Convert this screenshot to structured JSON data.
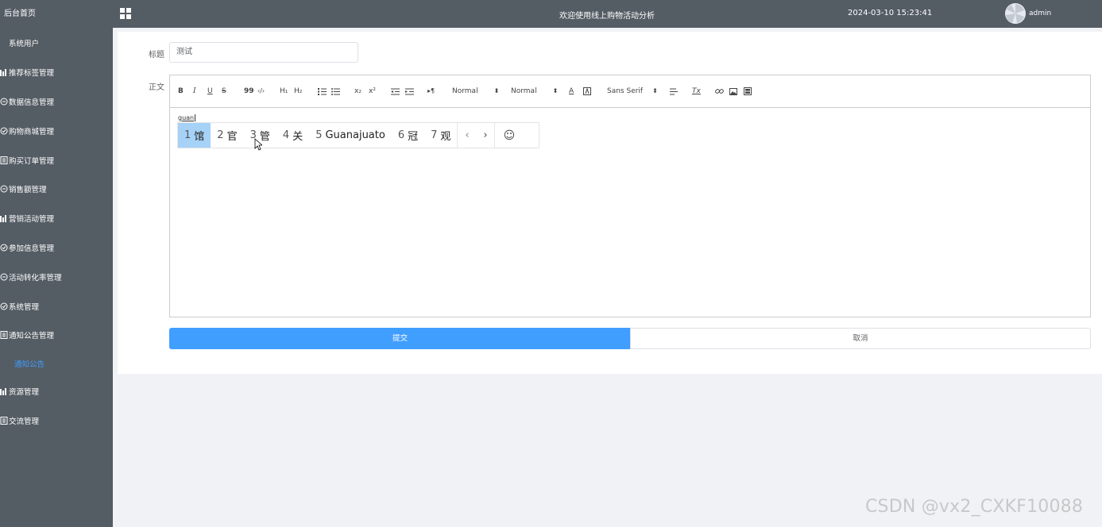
{
  "sidebar": {
    "home": "后台首页",
    "items": [
      {
        "label": "系统用户",
        "icon": "user-icon"
      },
      {
        "label": "推荐标签管理",
        "icon": "bar-chart-icon"
      },
      {
        "label": "数据信息管理",
        "icon": "circle-minus-icon"
      },
      {
        "label": "购物商城管理",
        "icon": "check-circle-icon"
      },
      {
        "label": "购买订单管理",
        "icon": "document-icon"
      },
      {
        "label": "销售额管理",
        "icon": "circle-minus-icon"
      },
      {
        "label": "营销活动管理",
        "icon": "bar-chart-icon"
      },
      {
        "label": "参加信息管理",
        "icon": "check-circle-icon"
      },
      {
        "label": "活动转化率管理",
        "icon": "circle-minus-icon"
      },
      {
        "label": "系统管理",
        "icon": "check-circle-icon"
      },
      {
        "label": "通知公告管理",
        "icon": "document-icon"
      }
    ],
    "active_sub": "通知公告",
    "items_after": [
      {
        "label": "资源管理",
        "icon": "bar-chart-icon"
      },
      {
        "label": "交流管理",
        "icon": "document-icon"
      }
    ]
  },
  "header": {
    "title": "欢迎使用线上购物活动分析",
    "datetime": "2024-03-10 15:23:41",
    "user": "admin"
  },
  "form": {
    "title_label": "标题",
    "title_value": "测试",
    "body_label": "正文",
    "editor_text": "guan",
    "submit_label": "提交",
    "cancel_label": "取消"
  },
  "toolbar": {
    "bold": "B",
    "italic": "I",
    "underline": "U",
    "strike": "S",
    "blockquote": "99",
    "code": "‹/›",
    "h1": "H₁",
    "h2": "H₂",
    "subscript": "x₂",
    "superscript": "x²",
    "rtl": "▸¶",
    "size_select": "Normal",
    "header_select": "Normal",
    "color": "A",
    "font_select": "Sans Serif",
    "clean": "Tx"
  },
  "ime": {
    "candidates": [
      {
        "num": "1",
        "text": "馆",
        "selected": true
      },
      {
        "num": "2",
        "text": "官",
        "selected": false
      },
      {
        "num": "3",
        "text": "管",
        "selected": false
      },
      {
        "num": "4",
        "text": "关",
        "selected": false
      },
      {
        "num": "5",
        "text": "Guanajuato",
        "selected": false
      },
      {
        "num": "6",
        "text": "冠",
        "selected": false
      },
      {
        "num": "7",
        "text": "观",
        "selected": false
      }
    ],
    "prev": "‹",
    "next": "›",
    "emoji": "☺"
  },
  "watermark": "CSDN @vx2_CXKF10088",
  "colors": {
    "sidebar_bg": "#545c64",
    "accent": "#409eff",
    "ime_selected": "#a6d2f7"
  }
}
